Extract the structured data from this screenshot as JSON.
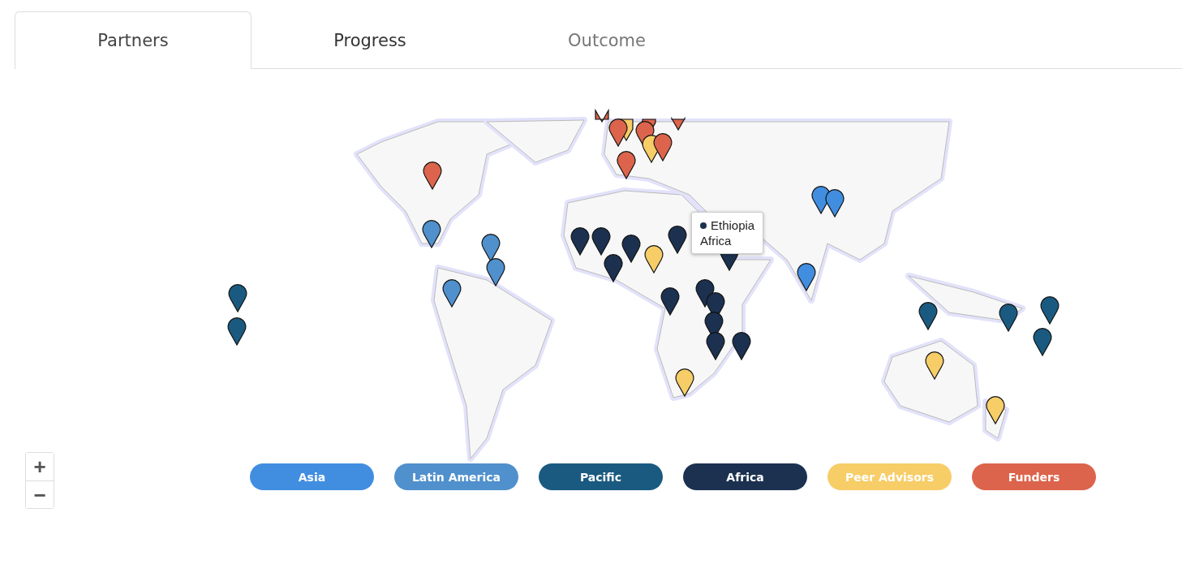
{
  "tabs": [
    {
      "label": "Partners",
      "selected": true,
      "disabled": false
    },
    {
      "label": "Progress",
      "selected": false,
      "disabled": false
    },
    {
      "label": "Outcome",
      "selected": false,
      "disabled": true
    }
  ],
  "tooltip": {
    "title": "Ethiopia",
    "subtitle": "Africa",
    "color": "#1c3150"
  },
  "zoom_controls": [
    {
      "label": "+"
    },
    {
      "label": "−"
    }
  ],
  "legend": [
    {
      "label": "Asia",
      "color": "#418ee0"
    },
    {
      "label": "Latin America",
      "color": "#4f90cd"
    },
    {
      "label": "Pacific",
      "color": "#1a5a80"
    },
    {
      "label": "Africa",
      "color": "#1c3150"
    },
    {
      "label": "Peer Advisors",
      "color": "#f7cd68"
    },
    {
      "label": "Funders",
      "color": "#dc644c"
    }
  ]
}
